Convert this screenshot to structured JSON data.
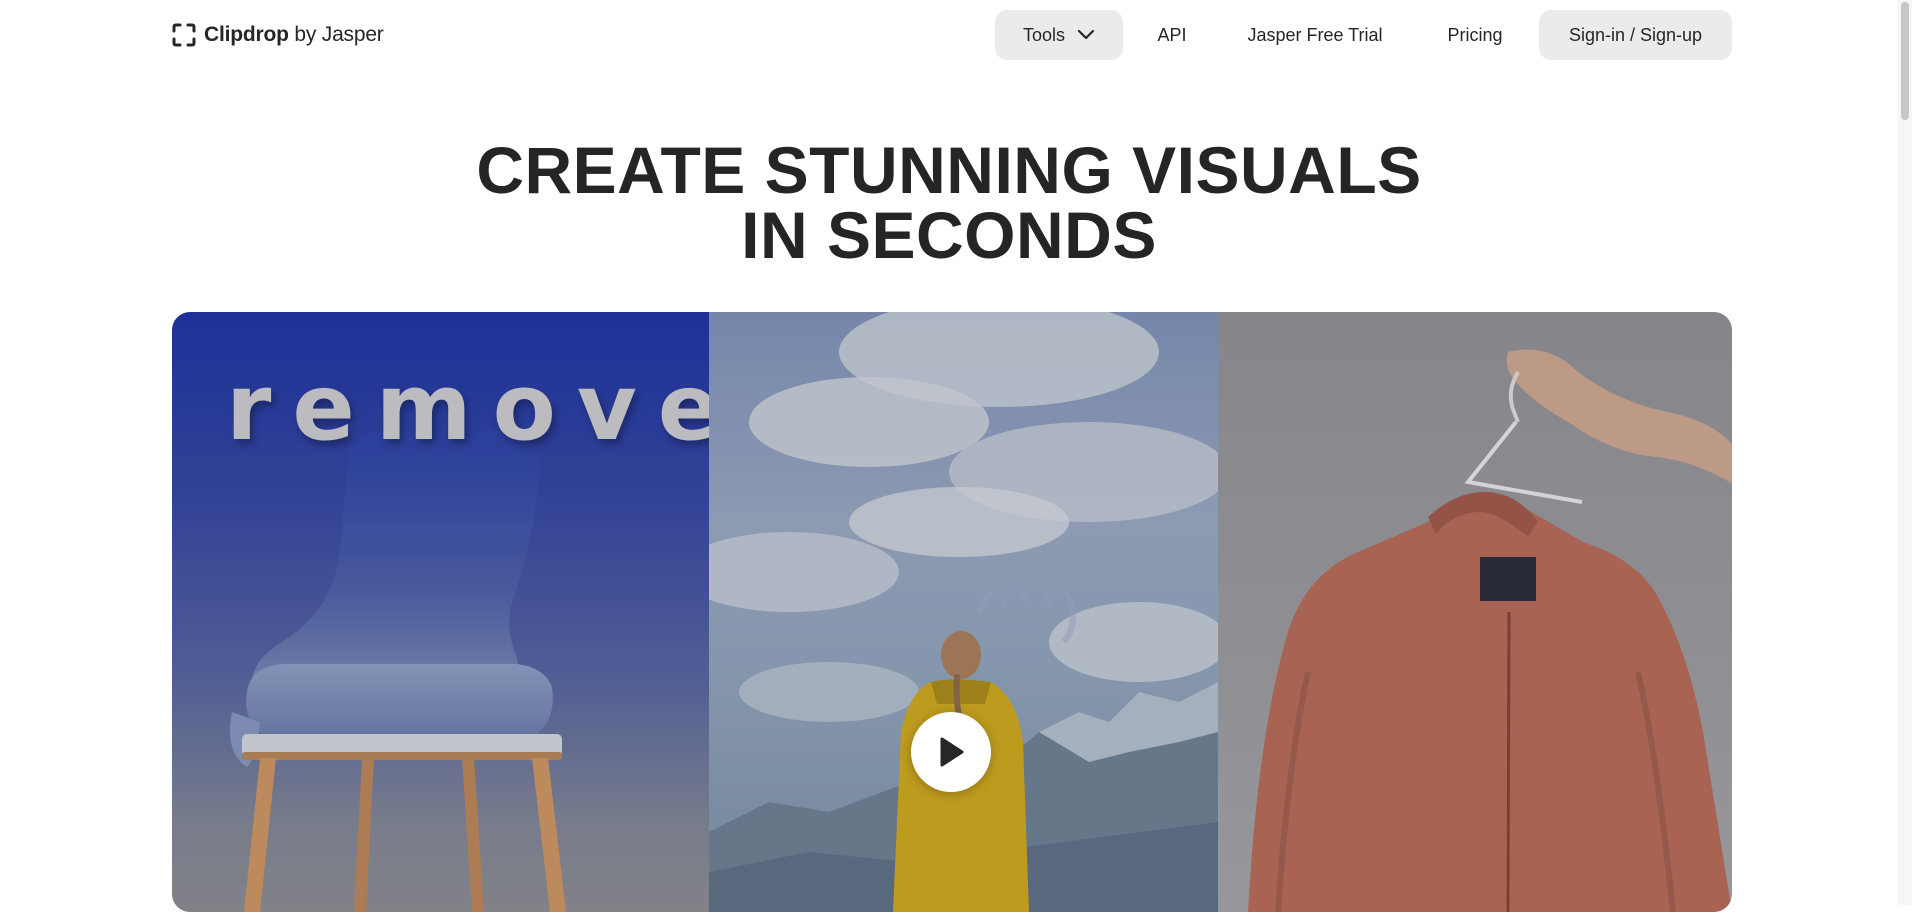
{
  "header": {
    "logo_icon": "corner-bracket-logo-icon",
    "brand_name": "Clipdrop",
    "brand_suffix": "by Jasper",
    "nav": {
      "tools_label": "Tools",
      "tools_icon": "chevron-down-icon",
      "api_label": "API",
      "trial_label": "Jasper Free Trial",
      "pricing_label": "Pricing",
      "signin_label": "Sign-in / Sign-up"
    }
  },
  "hero": {
    "headline_line1": "CREATE STUNNING VISUALS",
    "headline_line2": "IN SECONDS",
    "video": {
      "overlay_word": "remove",
      "play_icon": "play-icon",
      "panels": [
        "blue chair",
        "girl in yellow raincoat facing mountains",
        "salmon bomber jacket on hanger"
      ]
    }
  },
  "colors": {
    "text": "#262626",
    "pill_bg": "#ebebeb",
    "remove_panel_blue": "#1f35a2",
    "raincoat_yellow": "#c9a520",
    "jacket_salmon": "#b36a59"
  }
}
